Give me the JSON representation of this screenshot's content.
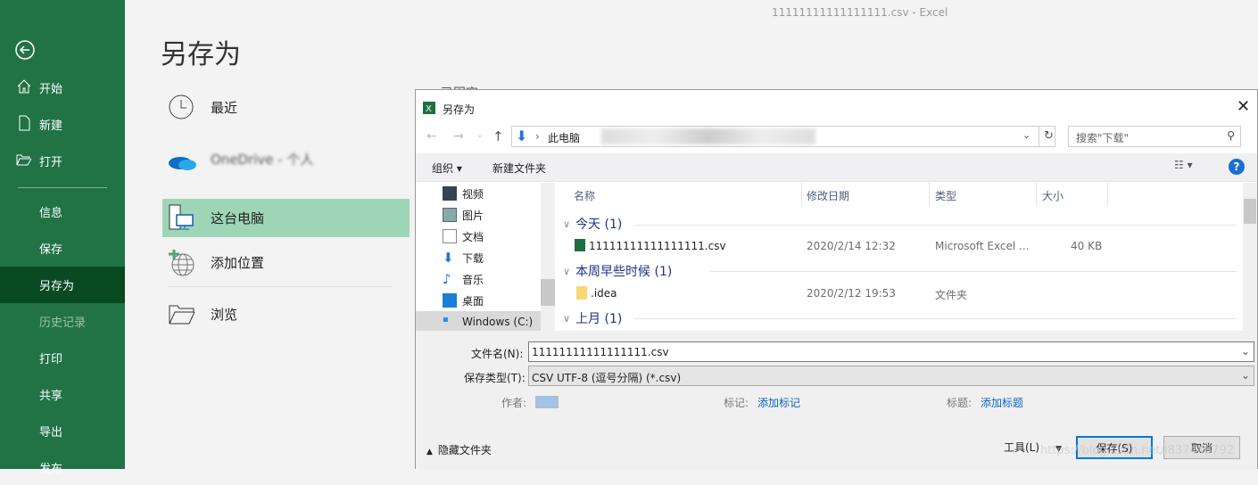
{
  "app_title": "11111111111111111.csv  -  Excel",
  "sidebar": {
    "items": [
      {
        "label": "开始",
        "icon": "home-icon"
      },
      {
        "label": "新建",
        "icon": "new-file-icon"
      },
      {
        "label": "打开",
        "icon": "open-folder-icon"
      },
      {
        "label": "信息"
      },
      {
        "label": "保存"
      },
      {
        "label": "另存为",
        "selected": true
      },
      {
        "label": "历史记录",
        "disabled": true
      },
      {
        "label": "打印"
      },
      {
        "label": "共享"
      },
      {
        "label": "导出"
      },
      {
        "label": "发布"
      }
    ]
  },
  "page_title": "另存为",
  "locations": [
    {
      "label": "最近"
    },
    {
      "label": "OneDrive - 个人"
    },
    {
      "label": "这台电脑"
    },
    {
      "label": "添加位置"
    },
    {
      "label": "浏览"
    }
  ],
  "behind_label": "已固定",
  "dialog": {
    "title": "另存为",
    "breadcrumb": "此电脑",
    "search_placeholder": "搜索\"下载\"",
    "toolbar": {
      "organize": "组织 ▾",
      "new_folder": "新建文件夹"
    },
    "nav": [
      "视频",
      "图片",
      "文档",
      "下载",
      "音乐",
      "桌面",
      "Windows (C:)"
    ],
    "columns": [
      "名称",
      "修改日期",
      "类型",
      "大小"
    ],
    "groups": [
      {
        "label": "今天 (1)",
        "files": [
          {
            "name": "11111111111111111.csv",
            "date": "2020/2/14 12:32",
            "type": "Microsoft Excel ...",
            "size": "40 KB"
          }
        ]
      },
      {
        "label": "本周早些时候 (1)",
        "files": [
          {
            "name": ".idea",
            "date": "2020/2/12 19:53",
            "type": "文件夹",
            "size": ""
          }
        ]
      },
      {
        "label": "上月 (1)",
        "files": []
      }
    ],
    "filename_label": "文件名(N):",
    "filename": "11111111111111111.csv",
    "filetype_label": "保存类型(T):",
    "filetype": "CSV UTF-8 (逗号分隔) (*.csv)",
    "author_label": "作者:",
    "tags_label": "标记:",
    "tags_link": "添加标记",
    "title_label": "标题:",
    "title_link": "添加标题",
    "hide_folders": "隐藏文件夹",
    "tools": "工具(L)",
    "save": "保存(S)",
    "cancel": "取消"
  },
  "watermark": "https://blog.csdn.net/l837448792"
}
